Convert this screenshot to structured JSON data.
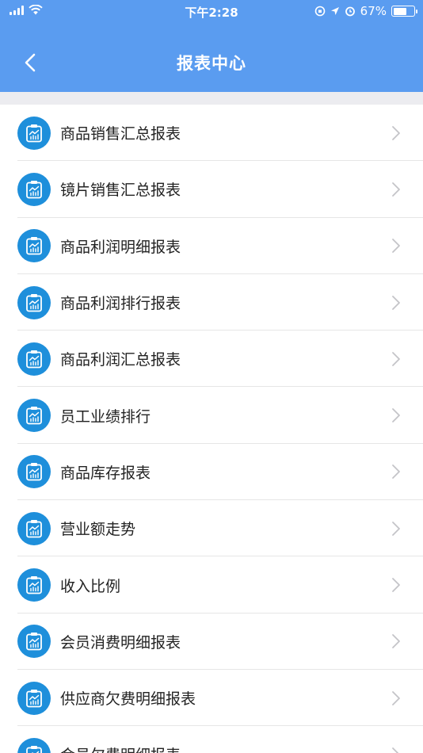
{
  "status_bar": {
    "time": "下午2:28",
    "battery_percent": "67%",
    "battery_level": 0.67
  },
  "nav": {
    "title": "报表中心",
    "back_icon": "chevron-left-icon"
  },
  "colors": {
    "header": "#5a9cf0",
    "icon_bg": "#1e8fdb",
    "separator": "#e6e6e6",
    "section_gap": "#ececf0"
  },
  "reports": [
    {
      "label": "商品销售汇总报表",
      "icon": "report-chart-icon"
    },
    {
      "label": "镜片销售汇总报表",
      "icon": "report-chart-icon"
    },
    {
      "label": "商品利润明细报表",
      "icon": "report-chart-icon"
    },
    {
      "label": "商品利润排行报表",
      "icon": "report-chart-icon"
    },
    {
      "label": "商品利润汇总报表",
      "icon": "report-chart-icon"
    },
    {
      "label": "员工业绩排行",
      "icon": "report-chart-icon"
    },
    {
      "label": "商品库存报表",
      "icon": "report-chart-icon"
    },
    {
      "label": "营业额走势",
      "icon": "report-chart-icon"
    },
    {
      "label": "收入比例",
      "icon": "report-chart-icon"
    },
    {
      "label": "会员消费明细报表",
      "icon": "report-chart-icon"
    },
    {
      "label": "供应商欠费明细报表",
      "icon": "report-chart-icon"
    },
    {
      "label": "会员欠费明细报表",
      "icon": "report-chart-icon"
    }
  ]
}
